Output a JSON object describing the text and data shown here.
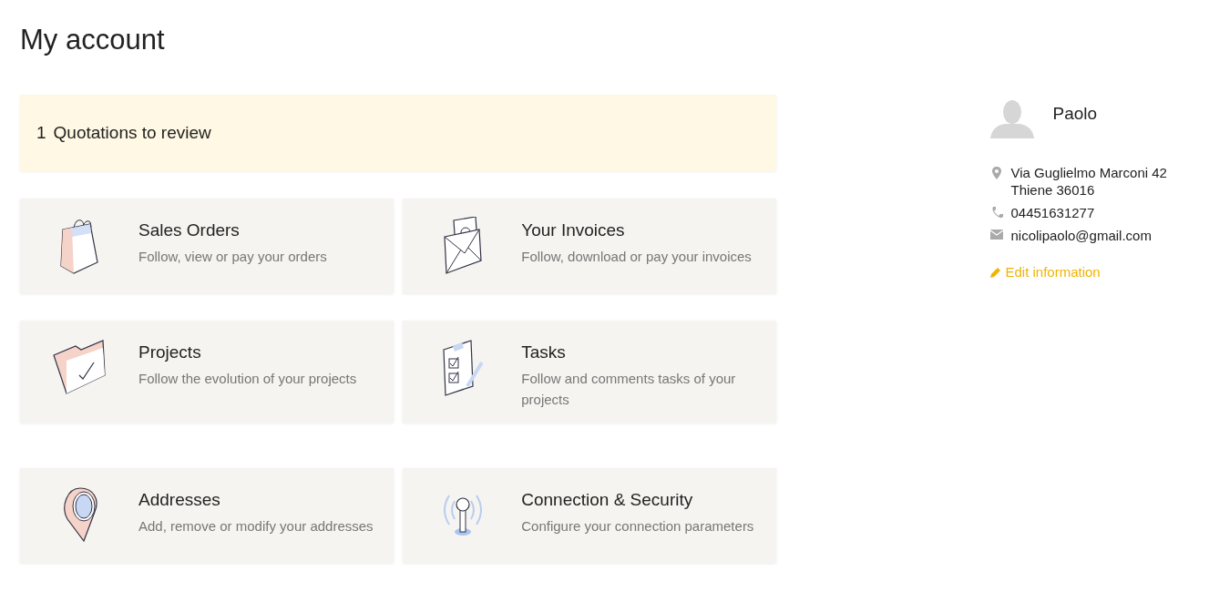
{
  "page_title": "My account",
  "alert": {
    "count": "1",
    "text": "Quotations to review"
  },
  "card_groups": [
    [
      {
        "kind": "bag",
        "title": "Sales Orders",
        "description": "Follow, view or pay your orders"
      },
      {
        "kind": "envelope",
        "title": "Your Invoices",
        "description": "Follow, download or pay your invoices"
      },
      {
        "kind": "folder",
        "title": "Projects",
        "description": "Follow the evolution of your projects"
      },
      {
        "kind": "clipboard",
        "title": "Tasks",
        "description": "Follow and comments tasks of your projects"
      }
    ],
    [
      {
        "kind": "pin",
        "title": "Addresses",
        "description": "Add, remove or modify your addresses"
      },
      {
        "kind": "antenna",
        "title": "Connection & Security",
        "description": "Configure your connection parameters"
      }
    ]
  ],
  "profile": {
    "name": "Paolo",
    "contacts": [
      {
        "kind": "address",
        "lines": [
          "Via Guglielmo Marconi 42",
          "Thiene 36016"
        ]
      },
      {
        "kind": "phone",
        "lines": [
          "04451631277"
        ]
      },
      {
        "kind": "email",
        "lines": [
          "nicolipaolo@gmail.com"
        ]
      }
    ],
    "edit_link": "Edit information"
  }
}
